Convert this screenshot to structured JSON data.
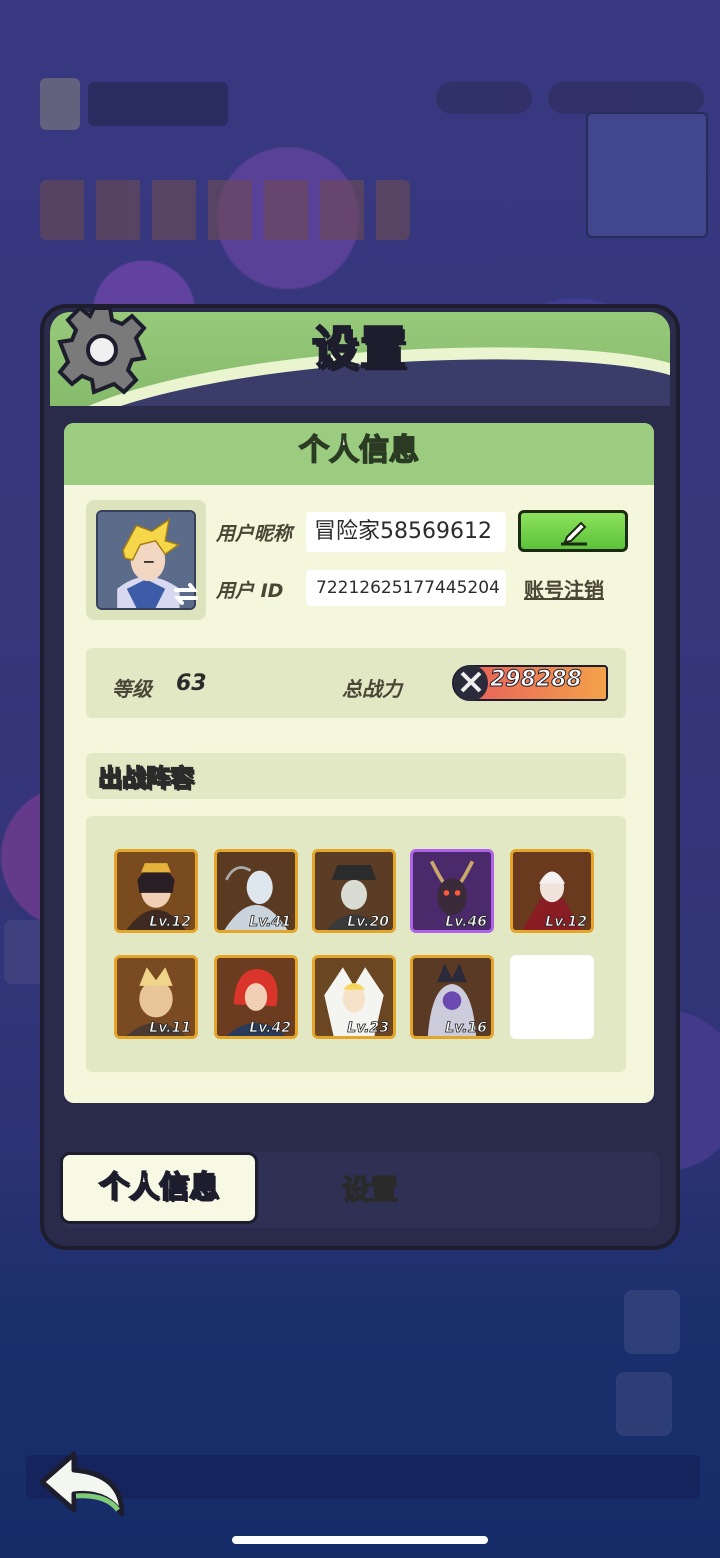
{
  "panel": {
    "title": "设置",
    "section_title": "个人信息"
  },
  "profile": {
    "nickname_label": "用户昵称",
    "nickname": "冒险家58569612",
    "id_label": "用户 ID",
    "user_id": "72212625177445204",
    "cancel_account": "账号注销"
  },
  "stats": {
    "level_label": "等级",
    "level": "63",
    "power_label": "总战力",
    "power": "298288"
  },
  "lineup": {
    "title": "出战阵容",
    "heroes": [
      {
        "level": "Lv.12"
      },
      {
        "level": "Lv.41"
      },
      {
        "level": "Lv.20"
      },
      {
        "level": "Lv.46"
      },
      {
        "level": "Lv.12"
      },
      {
        "level": "Lv.11"
      },
      {
        "level": "Lv.42"
      },
      {
        "level": "Lv.23"
      },
      {
        "level": "Lv.16"
      }
    ]
  },
  "tabs": {
    "profile": "个人信息",
    "settings": "设置"
  },
  "icons": {
    "gear": "gear-icon",
    "edit": "pencil-icon",
    "back": "back-arrow-icon",
    "swap": "swap-icon",
    "power": "swords-icon"
  },
  "colors": {
    "accent_green": "#8de25c",
    "header_green": "#9bcc80",
    "card_bg": "#f4f7dc",
    "hero_frame": "#e4a52b",
    "hero_frame_epic": "#b063e8"
  }
}
